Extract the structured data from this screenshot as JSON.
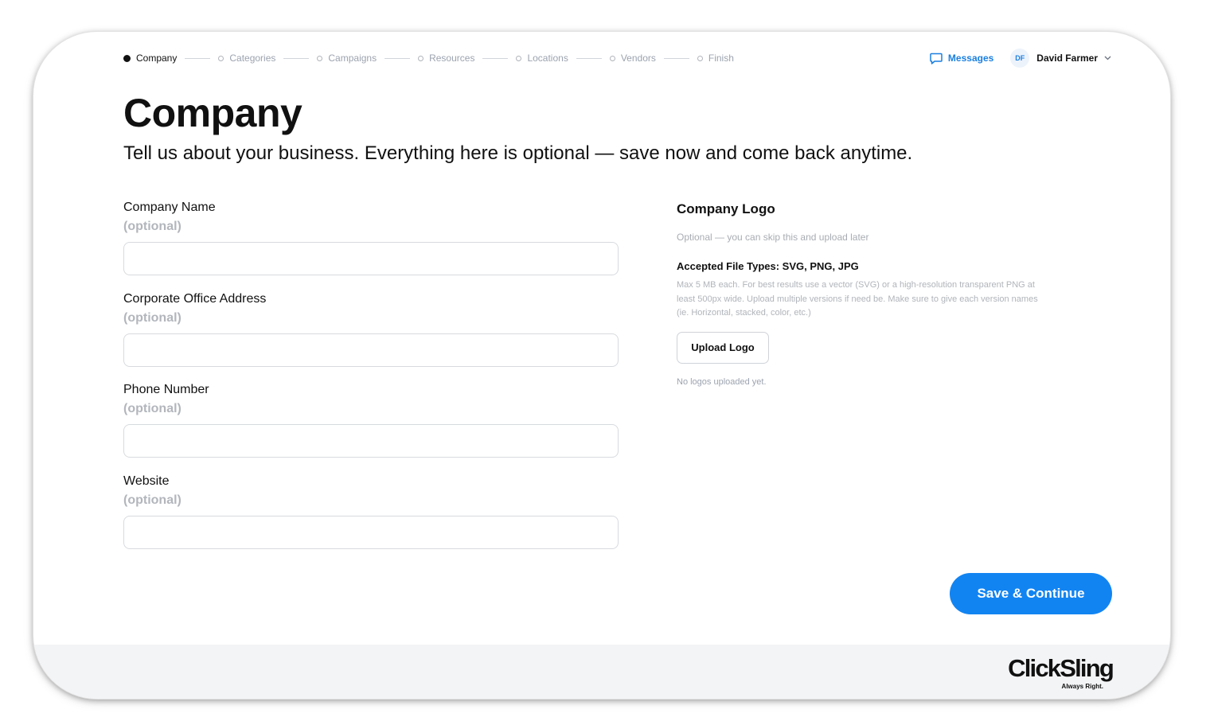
{
  "stepper": {
    "steps": [
      {
        "label": "Company",
        "active": true
      },
      {
        "label": "Categories",
        "active": false
      },
      {
        "label": "Campaigns",
        "active": false
      },
      {
        "label": "Resources",
        "active": false
      },
      {
        "label": "Locations",
        "active": false
      },
      {
        "label": "Vendors",
        "active": false
      },
      {
        "label": "Finish",
        "active": false
      }
    ]
  },
  "header": {
    "messages_label": "Messages",
    "user_initials": "DF",
    "user_name": "David Farmer"
  },
  "page": {
    "title": "Company",
    "subtitle": "Tell us about your business. Everything here is optional — save now and come back anytime."
  },
  "form": {
    "fields": [
      {
        "label": "Company Name",
        "hint": "(optional)",
        "value": ""
      },
      {
        "label": "Corporate Office Address",
        "hint": "(optional)",
        "value": ""
      },
      {
        "label": "Phone Number",
        "hint": "(optional)",
        "value": ""
      },
      {
        "label": "Website",
        "hint": "(optional)",
        "value": ""
      }
    ]
  },
  "logo": {
    "title": "Company Logo",
    "optional_note": "Optional — you can skip this and upload later",
    "file_types": "Accepted File Types: SVG, PNG, JPG",
    "description": "Max 5 MB each. For best results use a vector (SVG) or a high-resolution transparent PNG at least 500px wide. Upload multiple versions if need be. Make sure to give each version names (ie. Horizontal, stacked, color, etc.)",
    "upload_label": "Upload Logo",
    "status": "No logos uploaded yet."
  },
  "actions": {
    "save_label": "Save & Continue"
  },
  "footer": {
    "brand": "ClickSling",
    "tagline": "Always Right."
  },
  "colors": {
    "accent": "#1284f2",
    "link": "#1a7fe0",
    "muted": "#9ca3af",
    "footer_bg": "#f3f4f6"
  },
  "icons": {
    "messages": "chat-bubble-icon",
    "user_menu": "chevron-down-icon",
    "active_step": "filled-dot-icon",
    "pending_step": "hollow-circle-icon"
  }
}
